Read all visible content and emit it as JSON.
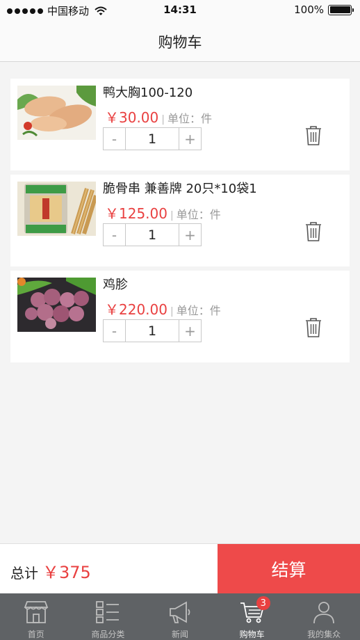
{
  "status_bar": {
    "carrier": "中国移动",
    "time": "14:31",
    "battery": "100%",
    "battery_level": 1.0
  },
  "header": {
    "title": "购物车"
  },
  "cart": {
    "items": [
      {
        "name": "鸭大胸100-120",
        "price": "￥30.00",
        "separator": "|",
        "unit": "单位：件",
        "quantity": "1",
        "minus": "-",
        "plus": "+",
        "image": "duck-breast"
      },
      {
        "name": "脆骨串 兼善牌 20只*10袋1",
        "price": "￥125.00",
        "separator": "|",
        "unit": "单位：件",
        "quantity": "1",
        "minus": "-",
        "plus": "+",
        "image": "cartilage-skewers"
      },
      {
        "name": "鸡胗",
        "price": "￥220.00",
        "separator": "|",
        "unit": "单位：件",
        "quantity": "1",
        "minus": "-",
        "plus": "+",
        "image": "chicken-gizzard"
      }
    ]
  },
  "summary": {
    "total_label": "总计",
    "total_value": "￥375",
    "checkout_label": "结算"
  },
  "tab_bar": {
    "tabs": [
      {
        "label": "首页",
        "icon": "shop-icon"
      },
      {
        "label": "商品分类",
        "icon": "category-list-icon"
      },
      {
        "label": "新闻",
        "icon": "megaphone-icon"
      },
      {
        "label": "购物车",
        "icon": "cart-icon",
        "badge": "3"
      },
      {
        "label": "我的集众",
        "icon": "user-icon"
      }
    ]
  },
  "colors": {
    "accent": "#ee4a4a",
    "price": "#e94040",
    "tab_bar": "#5f6265"
  }
}
